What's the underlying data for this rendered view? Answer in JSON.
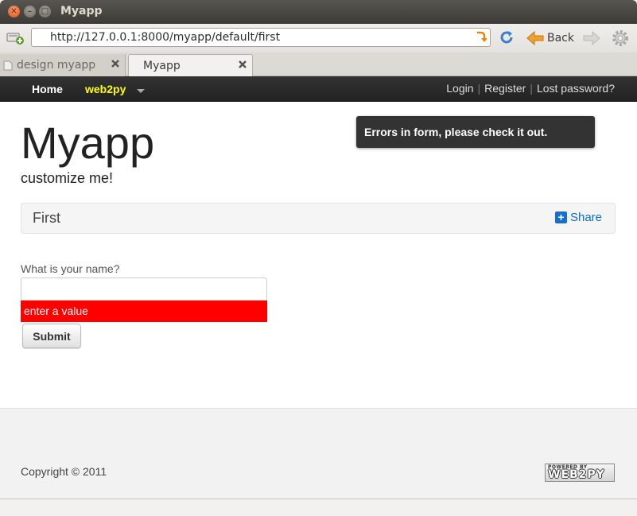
{
  "window": {
    "title": "Myapp"
  },
  "toolbar": {
    "url": "http://127.0.0.1:8000/myapp/default/first",
    "back_label": "Back"
  },
  "tabs": [
    {
      "label": "design myapp",
      "active": false
    },
    {
      "label": "Myapp",
      "active": true
    }
  ],
  "navbar": {
    "home": "Home",
    "brand": "web2py",
    "login": "Login",
    "register": "Register",
    "lost_password": "Lost password?",
    "separator": "|",
    "brand_color": "#ffff00"
  },
  "flash": {
    "message": "Errors in form, please check it out."
  },
  "header": {
    "title": "Myapp",
    "subtitle": "customize me!"
  },
  "page_header": {
    "title": "First",
    "share_label": "Share"
  },
  "form": {
    "label": "What is your name?",
    "value": "",
    "error": "enter a value",
    "submit_label": "Submit",
    "error_color": "#ff0000"
  },
  "footer": {
    "copyright": "Copyright © 2011",
    "powered_small": "POWERED BY",
    "powered_big": "WEB2PY"
  }
}
